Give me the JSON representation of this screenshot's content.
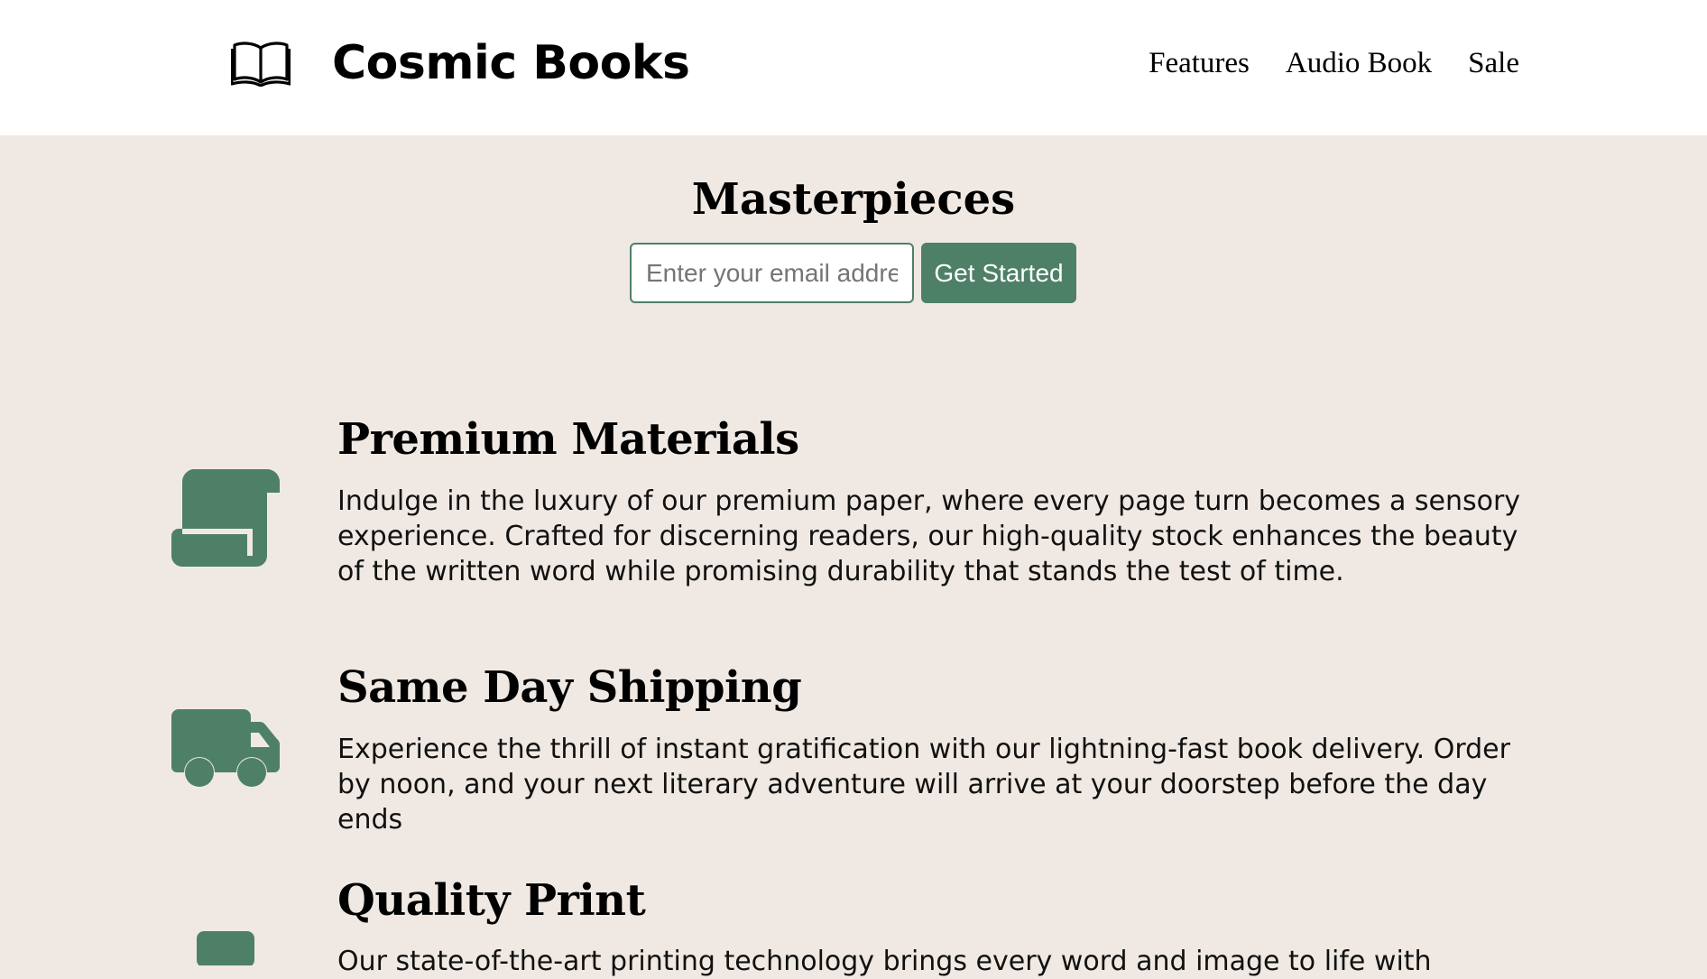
{
  "header": {
    "logo_icon": "open-book-icon",
    "brand": "Cosmic Books",
    "nav": [
      "Features",
      "Audio Book",
      "Sale"
    ]
  },
  "hero": {
    "title": "Masterpieces",
    "email_placeholder": "Enter your email address",
    "cta_label": "Get Started"
  },
  "colors": {
    "accent": "#4e8068",
    "background": "#f0e9e3",
    "header_bg": "#ffffff"
  },
  "features": [
    {
      "icon": "scroll-icon",
      "title": "Premium Materials",
      "text": "Indulge in the luxury of our premium paper, where every page turn becomes a sensory experience. Crafted for discerning readers, our high-quality stock enhances the beauty of the written word while promising durability that stands the test of time."
    },
    {
      "icon": "truck-icon",
      "title": "Same Day Shipping",
      "text": "Experience the thrill of instant gratification with our lightning-fast book delivery. Order by noon, and your next literary adventure will arrive at your doorstep before the day ends"
    },
    {
      "icon": "print-icon",
      "title": "Quality Print",
      "text": "Our state-of-the-art printing technology brings every word and image to life with"
    }
  ]
}
